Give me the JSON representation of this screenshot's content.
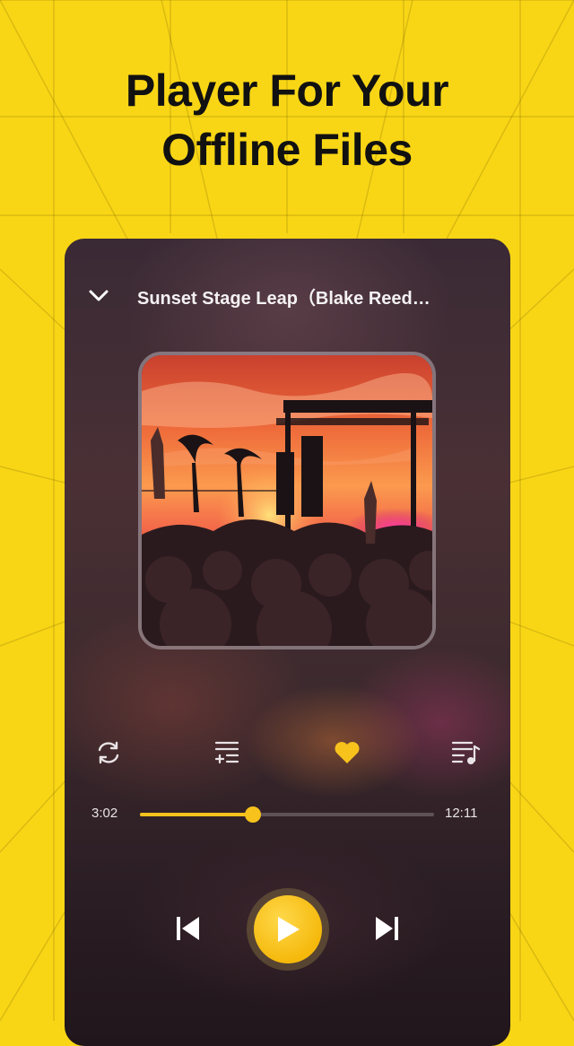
{
  "headline": {
    "line1": "Player For Your",
    "line2": "Offline Files"
  },
  "colors": {
    "background": "#f9d615",
    "accent": "#f7c21c",
    "headline": "#111111"
  },
  "player": {
    "title": "Sunset Stage Leap（Blake Reed…",
    "elapsed": "3:02",
    "duration": "12:11",
    "progress_fraction": 0.385,
    "favorite": true,
    "icons": {
      "collapse": "chevron-down-icon",
      "repeat": "repeat-icon",
      "queue": "playlist-add-icon",
      "favorite": "heart-icon",
      "lyrics": "music-queue-icon",
      "previous": "skip-previous-icon",
      "play": "play-icon",
      "next": "skip-next-icon"
    }
  }
}
